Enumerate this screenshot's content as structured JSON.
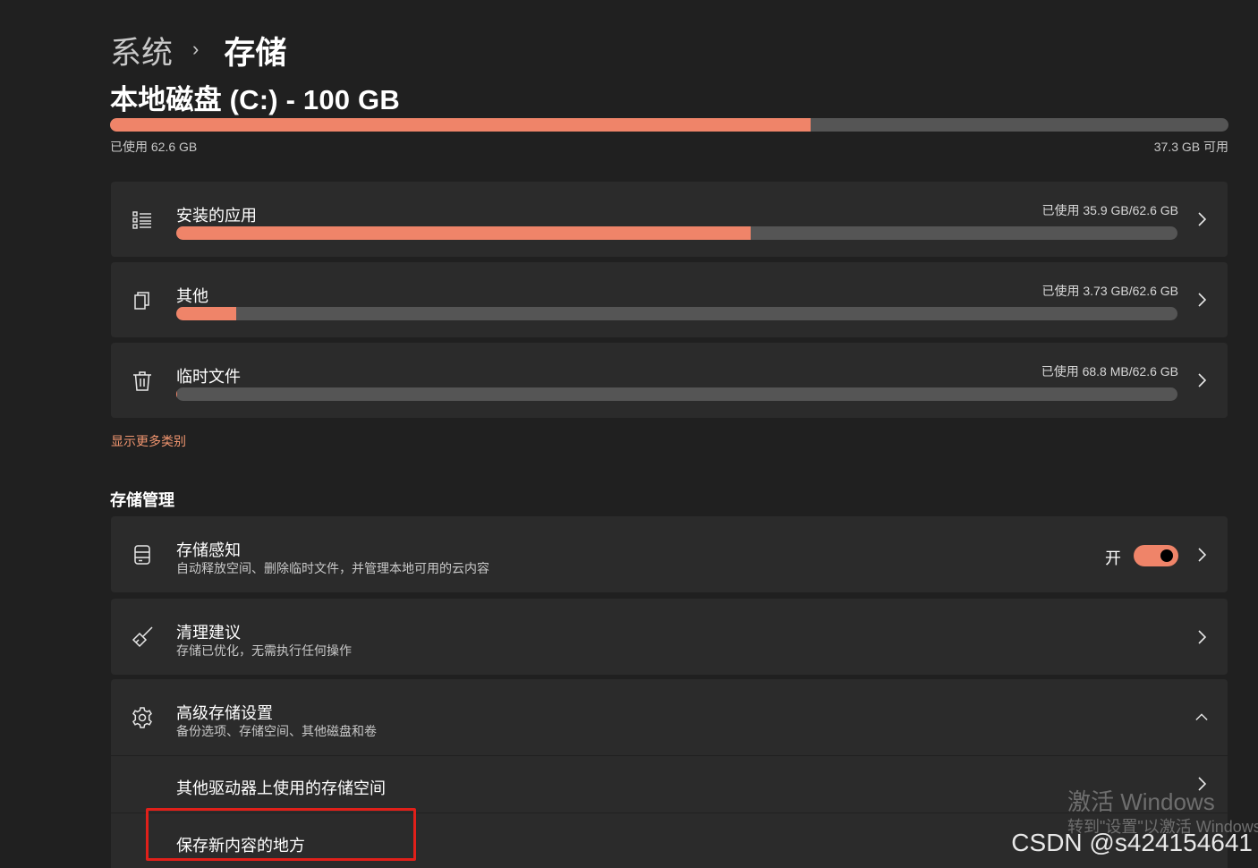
{
  "breadcrumb": {
    "parent": "系统",
    "separator": "›",
    "current": "存储"
  },
  "drive": {
    "title": "本地磁盘 (C:) - 100 GB",
    "used_label": "已使用 62.6 GB",
    "free_label": "37.3 GB 可用",
    "used_fraction": 0.626
  },
  "categories": [
    {
      "label": "安装的应用",
      "usage": "已使用 35.9 GB/62.6 GB",
      "fraction": 0.5735,
      "icon": "apps-list-icon"
    },
    {
      "label": "其他",
      "usage": "已使用 3.73 GB/62.6 GB",
      "fraction": 0.0596,
      "icon": "other-files-icon"
    },
    {
      "label": "临时文件",
      "usage": "已使用 68.8 MB/62.6 GB",
      "fraction": 0.0011,
      "icon": "trash-icon"
    }
  ],
  "show_more": "显示更多类别",
  "storage_management": {
    "title": "存储管理",
    "storage_sense": {
      "title": "存储感知",
      "description": "自动释放空间、删除临时文件，并管理本地可用的云内容",
      "toggle_label": "开",
      "toggle_on": true
    },
    "cleanup": {
      "title": "清理建议",
      "description": "存储已优化，无需执行任何操作"
    },
    "advanced": {
      "title": "高级存储设置",
      "description": "备份选项、存储空间、其他磁盘和卷",
      "expanded": true,
      "items": [
        {
          "label": "其他驱动器上使用的存储空间"
        },
        {
          "label": "保存新内容的地方"
        }
      ]
    }
  },
  "colors": {
    "accent": "#ef8469",
    "background": "#202020",
    "card": "#2b2b2b",
    "bar_track": "#555555",
    "link": "#f0956f",
    "highlight": "#e0201a"
  },
  "watermark": {
    "activate_title": "激活 Windows",
    "activate_sub": "转到\"设置\"以激活 Windows。",
    "csdn": "CSDN @s424154641"
  }
}
